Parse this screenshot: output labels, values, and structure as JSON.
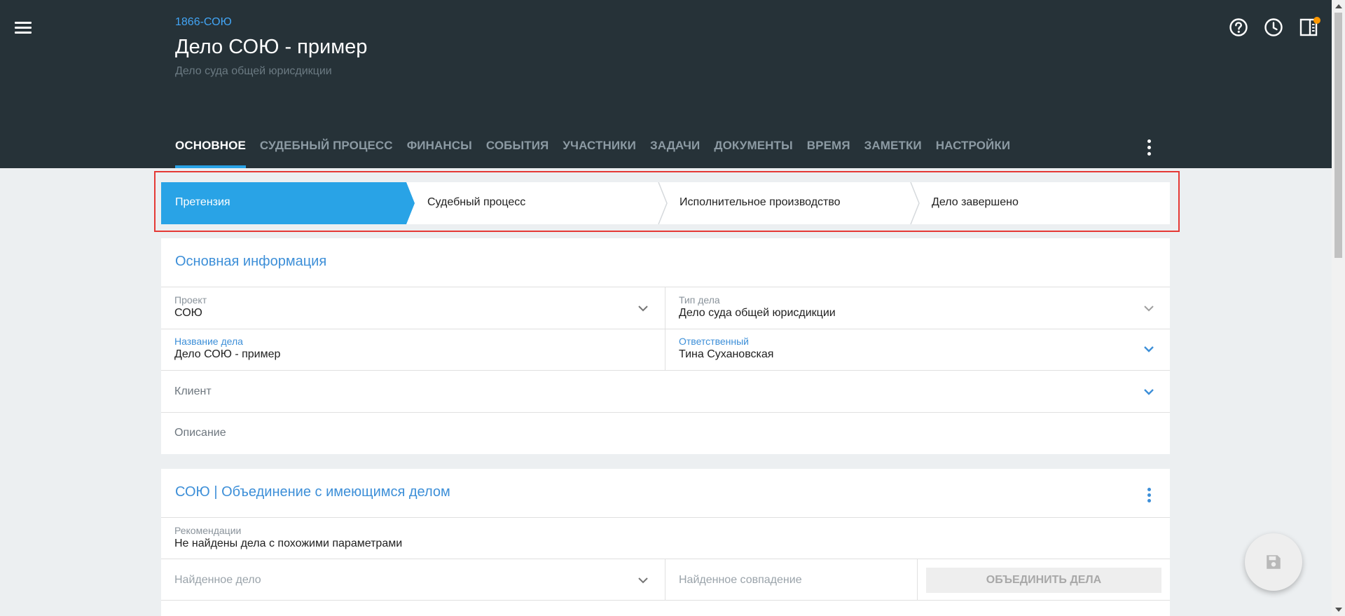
{
  "header": {
    "case_code": "1866-СОЮ",
    "title": "Дело СОЮ - пример",
    "subtitle": "Дело суда общей юрисдикции",
    "icons": [
      "help-icon",
      "history-clock-icon",
      "side-panel-icon"
    ]
  },
  "tabs": [
    {
      "label": "ОСНОВНОЕ",
      "active": true
    },
    {
      "label": "СУДЕБНЫЙ ПРОЦЕСС"
    },
    {
      "label": "ФИНАНСЫ"
    },
    {
      "label": "СОБЫТИЯ"
    },
    {
      "label": "УЧАСТНИКИ"
    },
    {
      "label": "ЗАДАЧИ"
    },
    {
      "label": "ДОКУМЕНТЫ"
    },
    {
      "label": "ВРЕМЯ"
    },
    {
      "label": "ЗАМЕТКИ"
    },
    {
      "label": "НАСТРОЙКИ"
    }
  ],
  "stages": [
    {
      "label": "Претензия",
      "active": true
    },
    {
      "label": "Судебный процесс"
    },
    {
      "label": "Исполнительное производство"
    },
    {
      "label": "Дело завершено"
    }
  ],
  "main_info": {
    "title": "Основная информация",
    "project_label": "Проект",
    "project_value": "СОЮ",
    "case_type_label": "Тип дела",
    "case_type_value": "Дело суда общей юрисдикции",
    "case_name_label": "Название дела",
    "case_name_value": "Дело СОЮ - пример",
    "responsible_label": "Ответственный",
    "responsible_value": "Тина Сухановская",
    "client_placeholder": "Клиент",
    "description_placeholder": "Описание"
  },
  "merge": {
    "title": "СОЮ | Объединение с имеющимся делом",
    "recommendations_label": "Рекомендации",
    "recommendations_value": "Не найдены дела с похожими параметрами",
    "found_case_placeholder": "Найденное дело",
    "found_match_placeholder": "Найденное совпадение",
    "merge_button": "ОБЪЕДИНИТЬ ДЕЛА"
  },
  "colors": {
    "header_bg": "#263238",
    "accent": "#29a3e6",
    "link_blue": "#3d8fd8",
    "highlight_frame": "#e53935",
    "notification": "#ff9800"
  }
}
